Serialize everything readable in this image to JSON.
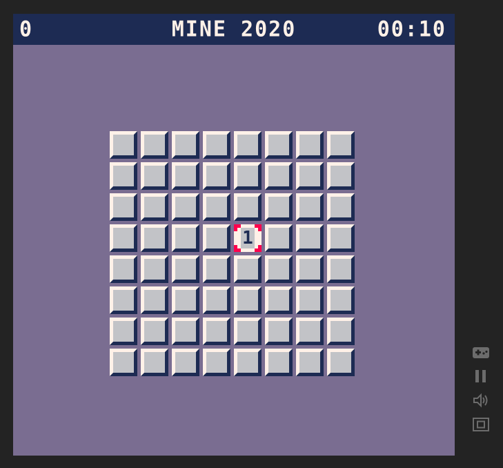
{
  "hud": {
    "flags": "0",
    "title": "MINE 2020",
    "timer": "00:10"
  },
  "board": {
    "rows": 8,
    "cols": 8,
    "revealed": [
      {
        "row": 3,
        "col": 4,
        "value": "1"
      }
    ],
    "cursor": {
      "row": 3,
      "col": 4
    }
  },
  "colors": {
    "background": "#7a6d91",
    "hud_bar": "#1d2b53",
    "tile": "#c2c3c7",
    "tile_highlight": "#fff1e8",
    "tile_shadow": "#1d2b53",
    "cursor": "#ff004d",
    "frame": "#232323",
    "controls": "#6c6c6c"
  },
  "controls": [
    {
      "name": "gamepad-icon"
    },
    {
      "name": "pause-icon"
    },
    {
      "name": "sound-icon"
    },
    {
      "name": "fullscreen-icon"
    }
  ]
}
